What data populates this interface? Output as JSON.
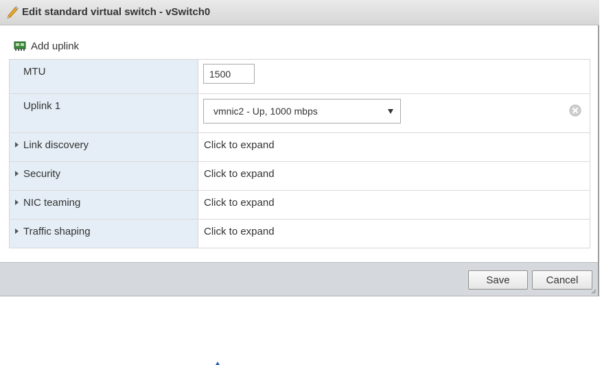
{
  "dialog": {
    "title": "Edit standard virtual switch - vSwitch0"
  },
  "toolbar": {
    "add_uplink_label": "Add uplink"
  },
  "settings": {
    "mtu": {
      "label": "MTU",
      "value": "1500"
    },
    "uplink1": {
      "label": "Uplink 1",
      "selected": "vmnic2 - Up, 1000 mbps"
    },
    "sections": [
      {
        "label": "Link discovery",
        "value": "Click to expand"
      },
      {
        "label": "Security",
        "value": "Click to expand"
      },
      {
        "label": "NIC teaming",
        "value": "Click to expand"
      },
      {
        "label": "Traffic shaping",
        "value": "Click to expand"
      }
    ]
  },
  "footer": {
    "save_label": "Save",
    "cancel_label": "Cancel"
  },
  "icons": {
    "title": "pencil-icon",
    "add_uplink": "network-card-icon",
    "remove_uplink": "remove-circle-icon",
    "dropdown": "dropdown-arrow-icon",
    "expand": "expand-caret-icon"
  },
  "colors": {
    "label_column_bg": "#e5eef6",
    "footer_bg": "#d5d8dc",
    "pencil": "#e8a82e"
  }
}
